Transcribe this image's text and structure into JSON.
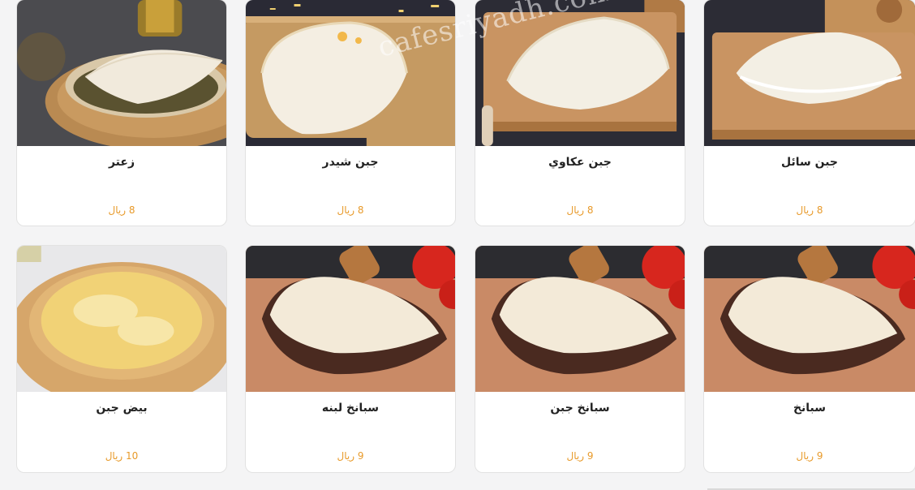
{
  "watermark": "cafesriyadh.com",
  "currency": "ريال",
  "colors": {
    "price": "#e89a2a",
    "card_bg": "#ffffff",
    "page_bg": "#f4f4f5"
  },
  "items": [
    {
      "name": "زعتر",
      "price": "8 ريال",
      "image": "zaatar-manakish"
    },
    {
      "name": "جبن شيدر",
      "price": "8 ريال",
      "image": "cheddar-cheese-manakish"
    },
    {
      "name": "جبن عكاوي",
      "price": "8 ريال",
      "image": "akkawi-cheese-manakish"
    },
    {
      "name": "جبن سائل",
      "price": "8 ريال",
      "image": "liquid-cheese-manakish"
    },
    {
      "name": "بيض جبن",
      "price": "10 ريال",
      "image": "egg-cheese-pie"
    },
    {
      "name": "سبانخ لبنه",
      "price": "9 ريال",
      "image": "spinach-labneh-manakish"
    },
    {
      "name": "سبانخ جبن",
      "price": "9 ريال",
      "image": "spinach-cheese-manakish"
    },
    {
      "name": "سبانخ",
      "price": "9 ريال",
      "image": "spinach-manakish"
    }
  ]
}
